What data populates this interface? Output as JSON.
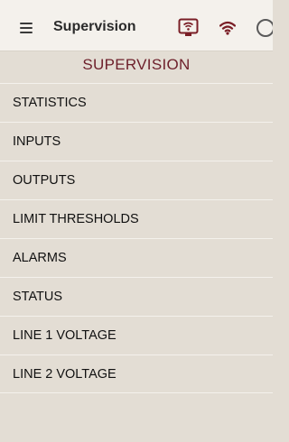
{
  "appbar": {
    "title": "Supervision",
    "icons": [
      "menu-icon",
      "device-wifi-icon",
      "wifi-icon",
      "circle-icon"
    ]
  },
  "page": {
    "title": "SUPERVISION"
  },
  "menu": {
    "items": [
      {
        "label": "STATISTICS"
      },
      {
        "label": "INPUTS"
      },
      {
        "label": "OUTPUTS"
      },
      {
        "label": "LIMIT THRESHOLDS"
      },
      {
        "label": "ALARMS"
      },
      {
        "label": "STATUS"
      },
      {
        "label": "LINE 1 VOLTAGE"
      },
      {
        "label": "LINE 2 VOLTAGE"
      }
    ]
  },
  "colors": {
    "background": "#e3ddd4",
    "appbar": "#f4f1ec",
    "title_accent": "#6d1f2a",
    "icon_accent": "#7a1e26"
  }
}
